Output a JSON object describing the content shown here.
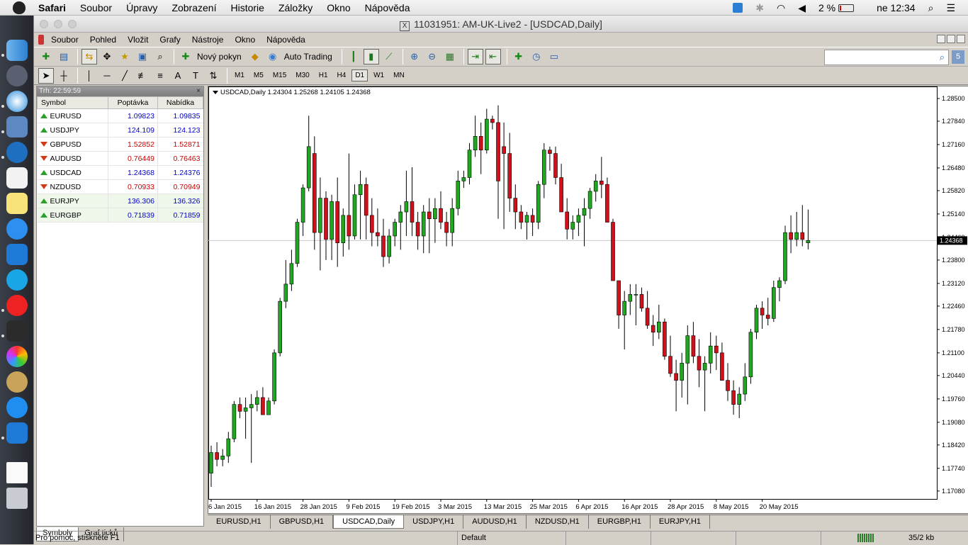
{
  "mac_menubar": {
    "app": "Safari",
    "items": [
      "Soubor",
      "Úpravy",
      "Zobrazení",
      "Historie",
      "Záložky",
      "Okno",
      "Nápověda"
    ],
    "battery": "2 %",
    "clock": "ne 12:34"
  },
  "window": {
    "title": "11031951: AM-UK-Live2 - [USDCAD,Daily]"
  },
  "app_menu": [
    "Soubor",
    "Pohled",
    "Vložit",
    "Grafy",
    "Nástroje",
    "Okno",
    "Nápověda"
  ],
  "toolbar": {
    "new_order": "Nový pokyn",
    "auto_trading": "Auto Trading",
    "search_placeholder": ""
  },
  "timeframes": [
    "M1",
    "M5",
    "M15",
    "M30",
    "H1",
    "H4",
    "D1",
    "W1",
    "MN"
  ],
  "active_timeframe": "D1",
  "market_watch": {
    "header": "Trh: 22:59:59",
    "columns": [
      "Symbol",
      "Poptávka",
      "Nabídka"
    ],
    "rows": [
      {
        "symbol": "EURUSD",
        "bid": "1.09823",
        "ask": "1.09835",
        "dir": "up"
      },
      {
        "symbol": "USDJPY",
        "bid": "124.109",
        "ask": "124.123",
        "dir": "up"
      },
      {
        "symbol": "GBPUSD",
        "bid": "1.52852",
        "ask": "1.52871",
        "dir": "down"
      },
      {
        "symbol": "AUDUSD",
        "bid": "0.76449",
        "ask": "0.76463",
        "dir": "down"
      },
      {
        "symbol": "USDCAD",
        "bid": "1.24368",
        "ask": "1.24376",
        "dir": "up"
      },
      {
        "symbol": "NZDUSD",
        "bid": "0.70933",
        "ask": "0.70949",
        "dir": "down"
      },
      {
        "symbol": "EURJPY",
        "bid": "136.306",
        "ask": "136.326",
        "dir": "up"
      },
      {
        "symbol": "EURGBP",
        "bid": "0.71839",
        "ask": "0.71859",
        "dir": "up"
      }
    ],
    "tabs": [
      "Symboly",
      "Graf ticků"
    ]
  },
  "chart": {
    "info": "USDCAD,Daily  1.24304 1.25268 1.24105 1.24368",
    "current_price": "1.24368",
    "up_color": "#1fa81f",
    "down_color": "#d0101a"
  },
  "chart_data": {
    "type": "candlestick",
    "symbol": "USDCAD",
    "timeframe": "Daily",
    "y_ticks": [
      "1.28500",
      "1.27840",
      "1.27160",
      "1.26480",
      "1.25820",
      "1.25140",
      "1.24460",
      "1.23800",
      "1.23120",
      "1.22460",
      "1.21780",
      "1.21100",
      "1.20440",
      "1.19760",
      "1.19080",
      "1.18420",
      "1.17740",
      "1.17080"
    ],
    "ylim": [
      1.1685,
      1.2885
    ],
    "x_ticks": [
      "6 Jan 2015",
      "16 Jan 2015",
      "28 Jan 2015",
      "9 Feb 2015",
      "19 Feb 2015",
      "3 Mar 2015",
      "13 Mar 2015",
      "25 Mar 2015",
      "6 Apr 2015",
      "16 Apr 2015",
      "28 Apr 2015",
      "8 May 2015",
      "20 May 2015"
    ],
    "x_tick_index": [
      0,
      8,
      16,
      24,
      32,
      40,
      48,
      56,
      64,
      72,
      80,
      88,
      96
    ],
    "ohlc": [
      [
        1.176,
        1.184,
        1.172,
        1.182
      ],
      [
        1.182,
        1.185,
        1.178,
        1.18
      ],
      [
        1.18,
        1.183,
        1.178,
        1.181
      ],
      [
        1.181,
        1.188,
        1.179,
        1.186
      ],
      [
        1.186,
        1.197,
        1.185,
        1.196
      ],
      [
        1.196,
        1.198,
        1.192,
        1.194
      ],
      [
        1.194,
        1.198,
        1.186,
        1.195
      ],
      [
        1.195,
        1.199,
        1.179,
        1.196
      ],
      [
        1.196,
        1.2,
        1.194,
        1.198
      ],
      [
        1.198,
        1.201,
        1.193,
        1.193
      ],
      [
        1.193,
        1.198,
        1.193,
        1.197
      ],
      [
        1.197,
        1.212,
        1.196,
        1.211
      ],
      [
        1.211,
        1.227,
        1.21,
        1.226
      ],
      [
        1.226,
        1.238,
        1.224,
        1.231
      ],
      [
        1.231,
        1.241,
        1.229,
        1.237
      ],
      [
        1.237,
        1.25,
        1.236,
        1.249
      ],
      [
        1.249,
        1.26,
        1.245,
        1.259
      ],
      [
        1.259,
        1.28,
        1.258,
        1.271
      ],
      [
        1.269,
        1.274,
        1.241,
        1.246
      ],
      [
        1.246,
        1.262,
        1.235,
        1.256
      ],
      [
        1.256,
        1.258,
        1.238,
        1.244
      ],
      [
        1.244,
        1.257,
        1.238,
        1.255
      ],
      [
        1.255,
        1.262,
        1.236,
        1.243
      ],
      [
        1.243,
        1.253,
        1.239,
        1.251
      ],
      [
        1.251,
        1.269,
        1.241,
        1.245
      ],
      [
        1.245,
        1.26,
        1.244,
        1.257
      ],
      [
        1.257,
        1.264,
        1.244,
        1.26
      ],
      [
        1.26,
        1.262,
        1.244,
        1.251
      ],
      [
        1.251,
        1.256,
        1.242,
        1.246
      ],
      [
        1.246,
        1.253,
        1.242,
        1.245
      ],
      [
        1.245,
        1.25,
        1.236,
        1.239
      ],
      [
        1.239,
        1.247,
        1.237,
        1.245
      ],
      [
        1.245,
        1.25,
        1.242,
        1.249
      ],
      [
        1.249,
        1.254,
        1.241,
        1.252
      ],
      [
        1.252,
        1.264,
        1.245,
        1.255
      ],
      [
        1.255,
        1.265,
        1.245,
        1.249
      ],
      [
        1.249,
        1.252,
        1.241,
        1.245
      ],
      [
        1.245,
        1.254,
        1.24,
        1.252
      ],
      [
        1.252,
        1.256,
        1.24,
        1.25
      ],
      [
        1.25,
        1.256,
        1.243,
        1.253
      ],
      [
        1.253,
        1.258,
        1.247,
        1.249
      ],
      [
        1.249,
        1.252,
        1.242,
        1.246
      ],
      [
        1.246,
        1.256,
        1.242,
        1.253
      ],
      [
        1.253,
        1.264,
        1.251,
        1.261
      ],
      [
        1.261,
        1.264,
        1.259,
        1.262
      ],
      [
        1.262,
        1.272,
        1.26,
        1.27
      ],
      [
        1.27,
        1.28,
        1.268,
        1.274
      ],
      [
        1.274,
        1.278,
        1.263,
        1.27
      ],
      [
        1.27,
        1.282,
        1.269,
        1.279
      ],
      [
        1.279,
        1.28,
        1.276,
        1.278
      ],
      [
        1.278,
        1.283,
        1.25,
        1.261
      ],
      [
        1.271,
        1.278,
        1.247,
        1.269
      ],
      [
        1.269,
        1.275,
        1.252,
        1.256
      ],
      [
        1.256,
        1.26,
        1.247,
        1.252
      ],
      [
        1.252,
        1.254,
        1.247,
        1.249
      ],
      [
        1.249,
        1.252,
        1.244,
        1.251
      ],
      [
        1.251,
        1.253,
        1.245,
        1.249
      ],
      [
        1.249,
        1.261,
        1.247,
        1.26
      ],
      [
        1.26,
        1.272,
        1.256,
        1.27
      ],
      [
        1.27,
        1.271,
        1.264,
        1.269
      ],
      [
        1.269,
        1.271,
        1.26,
        1.262
      ],
      [
        1.262,
        1.266,
        1.252,
        1.252
      ],
      [
        1.252,
        1.256,
        1.244,
        1.247
      ],
      [
        1.247,
        1.251,
        1.244,
        1.249
      ],
      [
        1.249,
        1.253,
        1.245,
        1.251
      ],
      [
        1.251,
        1.256,
        1.242,
        1.253
      ],
      [
        1.253,
        1.259,
        1.25,
        1.258
      ],
      [
        1.258,
        1.263,
        1.255,
        1.261
      ],
      [
        1.261,
        1.268,
        1.256,
        1.26
      ],
      [
        1.26,
        1.262,
        1.25,
        1.249
      ],
      [
        1.249,
        1.25,
        1.232,
        1.232
      ],
      [
        1.232,
        1.232,
        1.218,
        1.222
      ],
      [
        1.222,
        1.229,
        1.212,
        1.226
      ],
      [
        1.226,
        1.231,
        1.222,
        1.228
      ],
      [
        1.228,
        1.231,
        1.219,
        1.228
      ],
      [
        1.228,
        1.23,
        1.223,
        1.224
      ],
      [
        1.224,
        1.229,
        1.218,
        1.219
      ],
      [
        1.219,
        1.222,
        1.213,
        1.217
      ],
      [
        1.217,
        1.225,
        1.215,
        1.22
      ],
      [
        1.22,
        1.221,
        1.209,
        1.21
      ],
      [
        1.21,
        1.216,
        1.204,
        1.205
      ],
      [
        1.205,
        1.209,
        1.194,
        1.203
      ],
      [
        1.203,
        1.211,
        1.198,
        1.208
      ],
      [
        1.208,
        1.219,
        1.196,
        1.216
      ],
      [
        1.216,
        1.22,
        1.208,
        1.21
      ],
      [
        1.21,
        1.215,
        1.201,
        1.206
      ],
      [
        1.206,
        1.21,
        1.194,
        1.208
      ],
      [
        1.208,
        1.217,
        1.205,
        1.213
      ],
      [
        1.213,
        1.216,
        1.206,
        1.211
      ],
      [
        1.211,
        1.214,
        1.204,
        1.203
      ],
      [
        1.203,
        1.208,
        1.197,
        1.2
      ],
      [
        1.2,
        1.203,
        1.193,
        1.196
      ],
      [
        1.196,
        1.201,
        1.192,
        1.199
      ],
      [
        1.199,
        1.208,
        1.197,
        1.204
      ],
      [
        1.204,
        1.218,
        1.202,
        1.217
      ],
      [
        1.217,
        1.225,
        1.215,
        1.224
      ],
      [
        1.224,
        1.226,
        1.218,
        1.222
      ],
      [
        1.222,
        1.227,
        1.219,
        1.221
      ],
      [
        1.221,
        1.232,
        1.22,
        1.23
      ],
      [
        1.23,
        1.233,
        1.226,
        1.232
      ],
      [
        1.232,
        1.248,
        1.231,
        1.246
      ],
      [
        1.246,
        1.251,
        1.24,
        1.244
      ],
      [
        1.244,
        1.252,
        1.242,
        1.246
      ],
      [
        1.246,
        1.254,
        1.242,
        1.244
      ],
      [
        1.243,
        1.2527,
        1.2411,
        1.2437
      ]
    ]
  },
  "chart_tabs": [
    "EURUSD,H1",
    "GBPUSD,H1",
    "USDCAD,Daily",
    "USDJPY,H1",
    "AUDUSD,H1",
    "NZDUSD,H1",
    "EURGBP,H1",
    "EURJPY,H1"
  ],
  "active_chart_tab": "USDCAD,Daily",
  "statusbar": {
    "help": "Pro pomoc, stiskněte F1",
    "profile": "Default",
    "traffic": "35/2 kb"
  }
}
